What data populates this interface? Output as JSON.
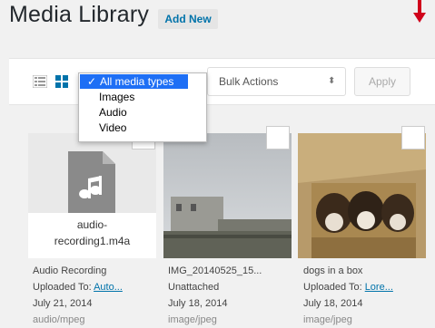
{
  "header": {
    "title": "Media Library",
    "add_new": "Add New"
  },
  "filter": {
    "selected": "All media types",
    "options": [
      "All media types",
      "Images",
      "Audio",
      "Video"
    ]
  },
  "bulk": {
    "label": "Bulk Actions",
    "apply": "Apply"
  },
  "items": [
    {
      "thumb_label_1": "audio-",
      "thumb_label_2": "recording1.m4a",
      "title": "Audio Recording",
      "uploaded_prefix": "Uploaded To:",
      "uploaded_link": "Auto...",
      "date": "July 21, 2014",
      "type": "audio/mpeg"
    },
    {
      "title": "IMG_20140525_15...",
      "uploaded": "Unattached",
      "date": "July 18, 2014",
      "type": "image/jpeg"
    },
    {
      "title": "dogs in a box",
      "uploaded_prefix": "Uploaded To:",
      "uploaded_link": "Lore...",
      "date": "July 18, 2014",
      "type": "image/jpeg"
    }
  ],
  "colors": {
    "accent": "#0073aa",
    "selected": "#1e6ff5",
    "arrow": "#d0021b"
  }
}
